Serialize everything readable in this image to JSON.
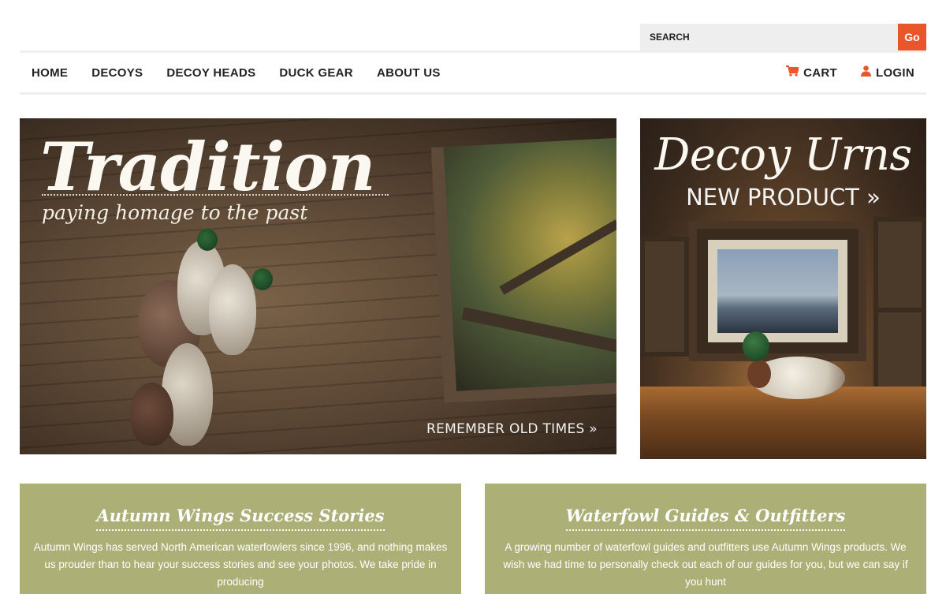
{
  "search": {
    "placeholder": "SEARCH",
    "button_label": "Go"
  },
  "nav": {
    "items": [
      {
        "label": "HOME"
      },
      {
        "label": "DECOYS"
      },
      {
        "label": "DECOY HEADS"
      },
      {
        "label": "DUCK GEAR"
      },
      {
        "label": "ABOUT US"
      }
    ],
    "cart_label": "CART",
    "login_label": "LOGIN",
    "cart_icon": "shopping-cart-icon",
    "login_icon": "user-icon"
  },
  "banners": {
    "main": {
      "title": "Tradition",
      "subtitle": "paying homage to the past",
      "cta": "REMEMBER OLD TIMES »"
    },
    "side": {
      "title": "Decoy Urns",
      "cta": "NEW PRODUCT »"
    }
  },
  "panels": [
    {
      "title": "Autumn Wings Success Stories",
      "body": "Autumn Wings has served North American waterfowlers since 1996, and nothing makes us prouder than to hear your success stories and see your photos. We take pride in producing"
    },
    {
      "title": "Waterfowl Guides & Outfitters",
      "body": "A growing number of waterfowl guides and outfitters use Autumn Wings products.  We wish we had time to personally check out each of our guides for you, but we can say if you hunt"
    }
  ],
  "colors": {
    "accent": "#e8562a",
    "panel": "#acb077",
    "nav_border": "#eeeeee",
    "search_bg": "#eeeeee"
  }
}
